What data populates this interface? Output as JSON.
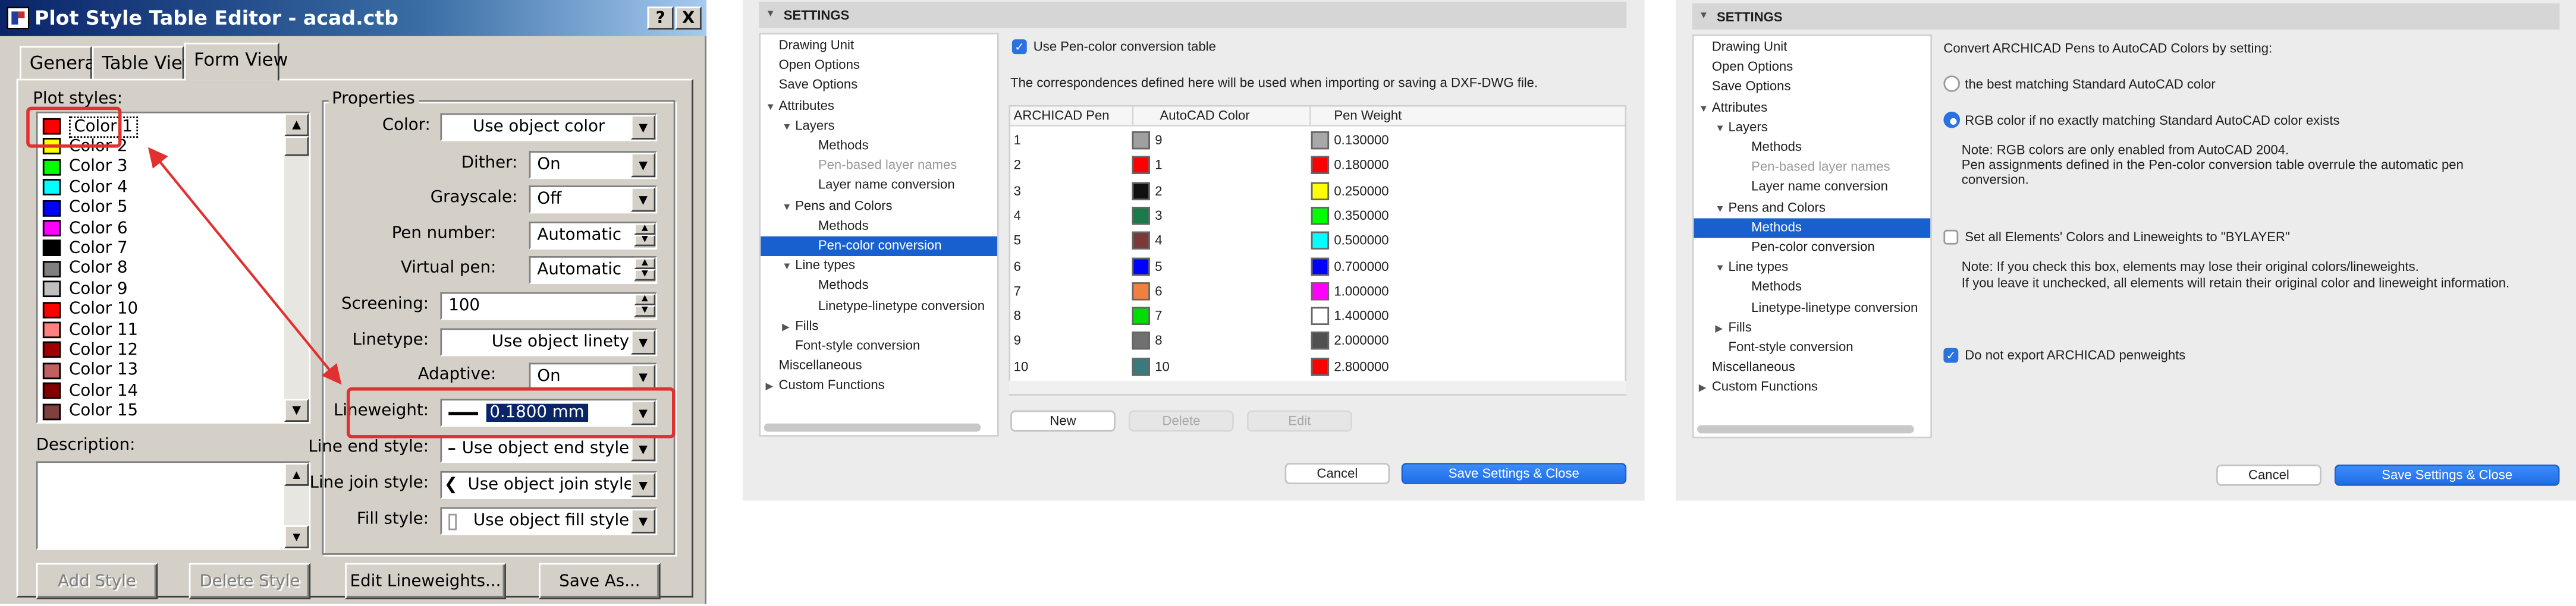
{
  "colors": {
    "win_face": "#d4d0c8",
    "win_title": "#0a246a",
    "annotation_red": "#e03030",
    "mac_selection": "#1860d0",
    "mac_primary": "#2a72e0"
  },
  "win_dialog": {
    "title": "Plot Style Table Editor - acad.ctb",
    "title_buttons": [
      "?",
      "X"
    ],
    "tabs": [
      "General",
      "Table View",
      "Form View"
    ],
    "active_tab": "Form View",
    "plot_styles_label": "Plot styles:",
    "plot_styles": [
      {
        "label": "Color 1",
        "color": "#ff0000"
      },
      {
        "label": "Color 2",
        "color": "#ffff00"
      },
      {
        "label": "Color 3",
        "color": "#00ff00"
      },
      {
        "label": "Color 4",
        "color": "#00ffff"
      },
      {
        "label": "Color 5",
        "color": "#0000ff"
      },
      {
        "label": "Color 6",
        "color": "#ff00ff"
      },
      {
        "label": "Color 7",
        "color": "#000000"
      },
      {
        "label": "Color 8",
        "color": "#808080"
      },
      {
        "label": "Color 9",
        "color": "#c0c0c0"
      },
      {
        "label": "Color 10",
        "color": "#ff0000"
      },
      {
        "label": "Color 11",
        "color": "#ff8080"
      },
      {
        "label": "Color 12",
        "color": "#a00000"
      },
      {
        "label": "Color 13",
        "color": "#c06060"
      },
      {
        "label": "Color 14",
        "color": "#800000"
      },
      {
        "label": "Color 15",
        "color": "#804040"
      }
    ],
    "selected_style": "Color 1",
    "description_label": "Description:",
    "properties_label": "Properties",
    "properties": {
      "color_label": "Color:",
      "color_value": "Use object color",
      "dither_label": "Dither:",
      "dither_value": "On",
      "grayscale_label": "Grayscale:",
      "grayscale_value": "Off",
      "pen_number_label": "Pen number:",
      "pen_number_value": "Automatic",
      "virtual_pen_label": "Virtual pen:",
      "virtual_pen_value": "Automatic",
      "screening_label": "Screening:",
      "screening_value": "100",
      "linetype_label": "Linetype:",
      "linetype_value": "Use object linety",
      "adaptive_label": "Adaptive:",
      "adaptive_value": "On",
      "lineweight_label": "Lineweight:",
      "lineweight_value": "0.1800 mm",
      "line_end_label": "Line end style:",
      "line_end_value": "Use object end style",
      "line_join_label": "Line join style:",
      "line_join_value": "Use object join style",
      "fill_label": "Fill style:",
      "fill_value": "Use object fill style"
    },
    "buttons": {
      "add_style": "Add Style",
      "delete_style": "Delete Style",
      "edit_lineweights": "Edit Lineweights...",
      "save_as": "Save As..."
    }
  },
  "settings_tree": {
    "header": "SETTINGS",
    "nodes": [
      {
        "label": "Drawing Unit",
        "level": 0,
        "arrow": ""
      },
      {
        "label": "Open Options",
        "level": 0,
        "arrow": ""
      },
      {
        "label": "Save Options",
        "level": 0,
        "arrow": ""
      },
      {
        "label": "Attributes",
        "level": 0,
        "arrow": "open"
      },
      {
        "label": "Layers",
        "level": 1,
        "arrow": "open"
      },
      {
        "label": "Methods",
        "level": 2,
        "arrow": ""
      },
      {
        "label": "Pen-based layer names",
        "level": 2,
        "arrow": "",
        "dim": true
      },
      {
        "label": "Layer name conversion",
        "level": 2,
        "arrow": ""
      },
      {
        "label": "Pens and Colors",
        "level": 1,
        "arrow": "open"
      },
      {
        "label": "Methods",
        "level": 2,
        "arrow": ""
      },
      {
        "label": "Pen-color conversion",
        "level": 2,
        "arrow": ""
      },
      {
        "label": "Line types",
        "level": 1,
        "arrow": "open"
      },
      {
        "label": "Methods",
        "level": 2,
        "arrow": ""
      },
      {
        "label": "Linetype-linetype conversion",
        "level": 2,
        "arrow": ""
      },
      {
        "label": "Fills",
        "level": 1,
        "arrow": "closed"
      },
      {
        "label": "Font-style conversion",
        "level": 1,
        "arrow": ""
      },
      {
        "label": "Miscellaneous",
        "level": 0,
        "arrow": ""
      },
      {
        "label": "Custom Functions",
        "level": 0,
        "arrow": "closed"
      }
    ]
  },
  "panel2": {
    "selected_node_index": 10,
    "use_pen_color_label": "Use Pen-color conversion table",
    "use_pen_color_checked": true,
    "info": "The correspondences defined here will be used when importing or saving a DXF-DWG file.",
    "columns": [
      "ARCHICAD Pen",
      "AutoCAD Color",
      "Pen Weight"
    ],
    "rows": [
      {
        "pen": "1",
        "acad_color": "9",
        "acad_swatch": "#a0a0a0",
        "weight": "0.130000",
        "weight_swatch": "#a8a8a8"
      },
      {
        "pen": "2",
        "acad_color": "1",
        "acad_swatch": "#ff0000",
        "weight": "0.180000",
        "weight_swatch": "#ff0000"
      },
      {
        "pen": "3",
        "acad_color": "2",
        "acad_swatch": "#111111",
        "weight": "0.250000",
        "weight_swatch": "#ffff00"
      },
      {
        "pen": "4",
        "acad_color": "3",
        "acad_swatch": "#1a7a4a",
        "weight": "0.350000",
        "weight_swatch": "#00ff00"
      },
      {
        "pen": "5",
        "acad_color": "4",
        "acad_swatch": "#7a3a3a",
        "weight": "0.500000",
        "weight_swatch": "#00ffff"
      },
      {
        "pen": "6",
        "acad_color": "5",
        "acad_swatch": "#0000ff",
        "weight": "0.700000",
        "weight_swatch": "#0000ff"
      },
      {
        "pen": "7",
        "acad_color": "6",
        "acad_swatch": "#f08040",
        "weight": "1.000000",
        "weight_swatch": "#ff00ff"
      },
      {
        "pen": "8",
        "acad_color": "7",
        "acad_swatch": "#00dd00",
        "weight": "1.400000",
        "weight_swatch": "#ffffff"
      },
      {
        "pen": "9",
        "acad_color": "8",
        "acad_swatch": "#707070",
        "weight": "2.000000",
        "weight_swatch": "#505050"
      },
      {
        "pen": "10",
        "acad_color": "10",
        "acad_swatch": "#3a7a7a",
        "weight": "2.800000",
        "weight_swatch": "#ff0000"
      }
    ],
    "buttons": {
      "new": "New",
      "delete": "Delete",
      "edit": "Edit"
    },
    "cancel": "Cancel",
    "save_close": "Save Settings & Close"
  },
  "panel3": {
    "selected_node_index": 9,
    "intro": "Convert ARCHICAD Pens to AutoCAD Colors by setting:",
    "option1": "the best matching Standard AutoCAD color",
    "option2": "RGB color if no exactly matching Standard AutoCAD color exists",
    "selected_option": 2,
    "note1_line1": "Note: RGB colors are only enabled from AutoCAD 2004.",
    "note1_line2": "Pen assignments defined in the Pen-color conversion table overrule the automatic pen",
    "note1_line3": "conversion.",
    "bylayer_label": "Set all Elements' Colors and Lineweights to \"BYLAYER\"",
    "bylayer_checked": false,
    "note2_line1": "Note: If you check this box, elements may lose their original colors/lineweights.",
    "note2_line2": "If you leave it unchecked, all elements will retain their original color and lineweight information.",
    "penweights_label": "Do not export ARCHICAD penweights",
    "penweights_checked": true,
    "cancel": "Cancel",
    "save_close": "Save Settings & Close"
  }
}
